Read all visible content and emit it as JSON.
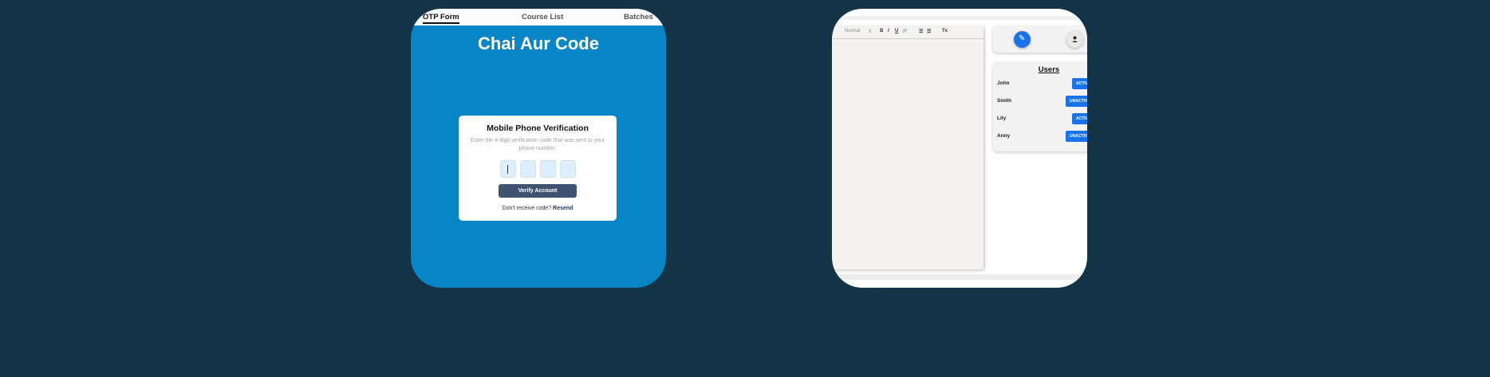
{
  "otp_card": {
    "nav": {
      "items": [
        {
          "label": "OTP Form",
          "active": true
        },
        {
          "label": "Course List",
          "active": false
        },
        {
          "label": "Batches",
          "active": false
        }
      ]
    },
    "brand": "Chai Aur Code",
    "form": {
      "title": "Mobile Phone Verification",
      "description": "Enter the 4-digit verification code that was sent to your phone number.",
      "digits": [
        "",
        "",
        "",
        ""
      ],
      "verify_label": "Verify Account",
      "resend_prompt": "Don't receive code?",
      "resend_link": "Resend"
    }
  },
  "editor_card": {
    "toolbar": {
      "format": "Normal",
      "format_arrow": "⇕",
      "bold": "B",
      "italic": "I",
      "underline": "U",
      "link": "🔗",
      "ordered_list": "☰",
      "bullet_list": "☰",
      "clear": "Tx"
    },
    "actions": {
      "edit_icon": "✎",
      "user_icon": "👤"
    },
    "users": {
      "title": "Users",
      "items": [
        {
          "name": "John",
          "button": "ACTIVATE"
        },
        {
          "name": "Smith",
          "button": "UNACTIVATE"
        },
        {
          "name": "Lily",
          "button": "ACTIVATE"
        },
        {
          "name": "Anny",
          "button": "UNACTIVATE"
        }
      ]
    }
  },
  "colors": {
    "page_bg": "#133347",
    "otp_bg": "#0785c6",
    "verify_button": "#3e5371",
    "accent_blue": "#1a73e8"
  }
}
